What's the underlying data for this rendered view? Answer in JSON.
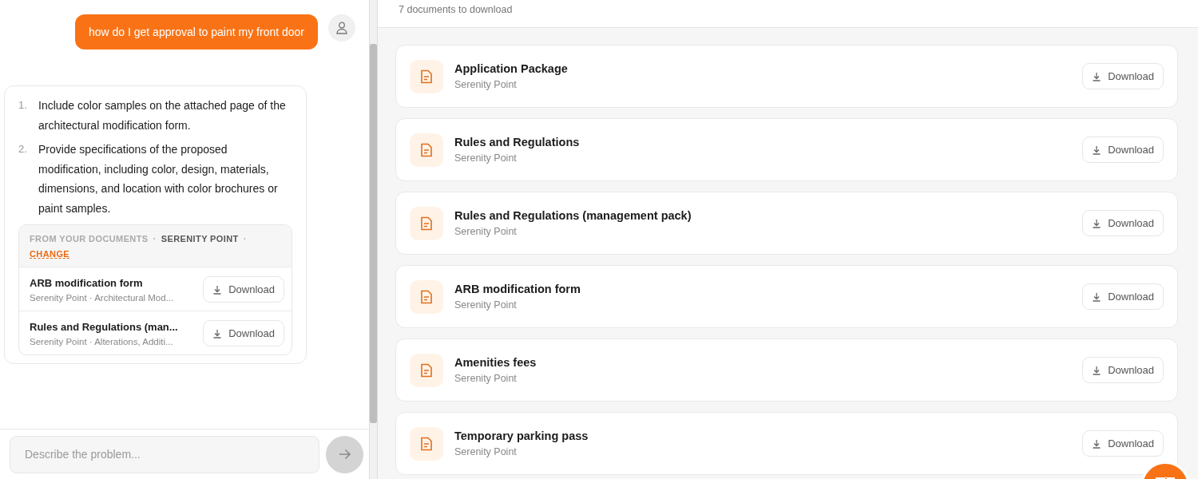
{
  "chat": {
    "user_message": "how do I get approval to paint my front door",
    "answer": {
      "steps": [
        {
          "number": "1.",
          "text": "Include color samples on the attached page of the architectural modification form."
        },
        {
          "number": "2.",
          "text": "Provide specifications of the proposed modification, including color, design, materials, dimensions, and location with color brochures or paint samples."
        }
      ],
      "sources": {
        "label": "FROM YOUR DOCUMENTS",
        "separator": "·",
        "community": "SERENITY POINT",
        "separator_2": "·",
        "change_link": "CHANGE",
        "documents": [
          {
            "title": "ARB modification form",
            "subtitle": "Serenity Point · Architectural Mod...",
            "button": "Download"
          },
          {
            "title": "Rules and Regulations (man...",
            "subtitle": "Serenity Point · Alterations, Additi...",
            "button": "Download"
          }
        ]
      }
    },
    "input": {
      "placeholder": "Describe the problem..."
    }
  },
  "documents_panel": {
    "count_text": "7 documents to download",
    "documents": [
      {
        "title": "Application Package",
        "subtitle": "Serenity Point",
        "button": "Download"
      },
      {
        "title": "Rules and Regulations",
        "subtitle": "Serenity Point",
        "button": "Download"
      },
      {
        "title": "Rules and Regulations (management pack)",
        "subtitle": "Serenity Point",
        "button": "Download"
      },
      {
        "title": "ARB modification form",
        "subtitle": "Serenity Point",
        "button": "Download"
      },
      {
        "title": "Amenities fees",
        "subtitle": "Serenity Point",
        "button": "Download"
      },
      {
        "title": "Temporary parking pass",
        "subtitle": "Serenity Point",
        "button": "Download"
      }
    ]
  }
}
